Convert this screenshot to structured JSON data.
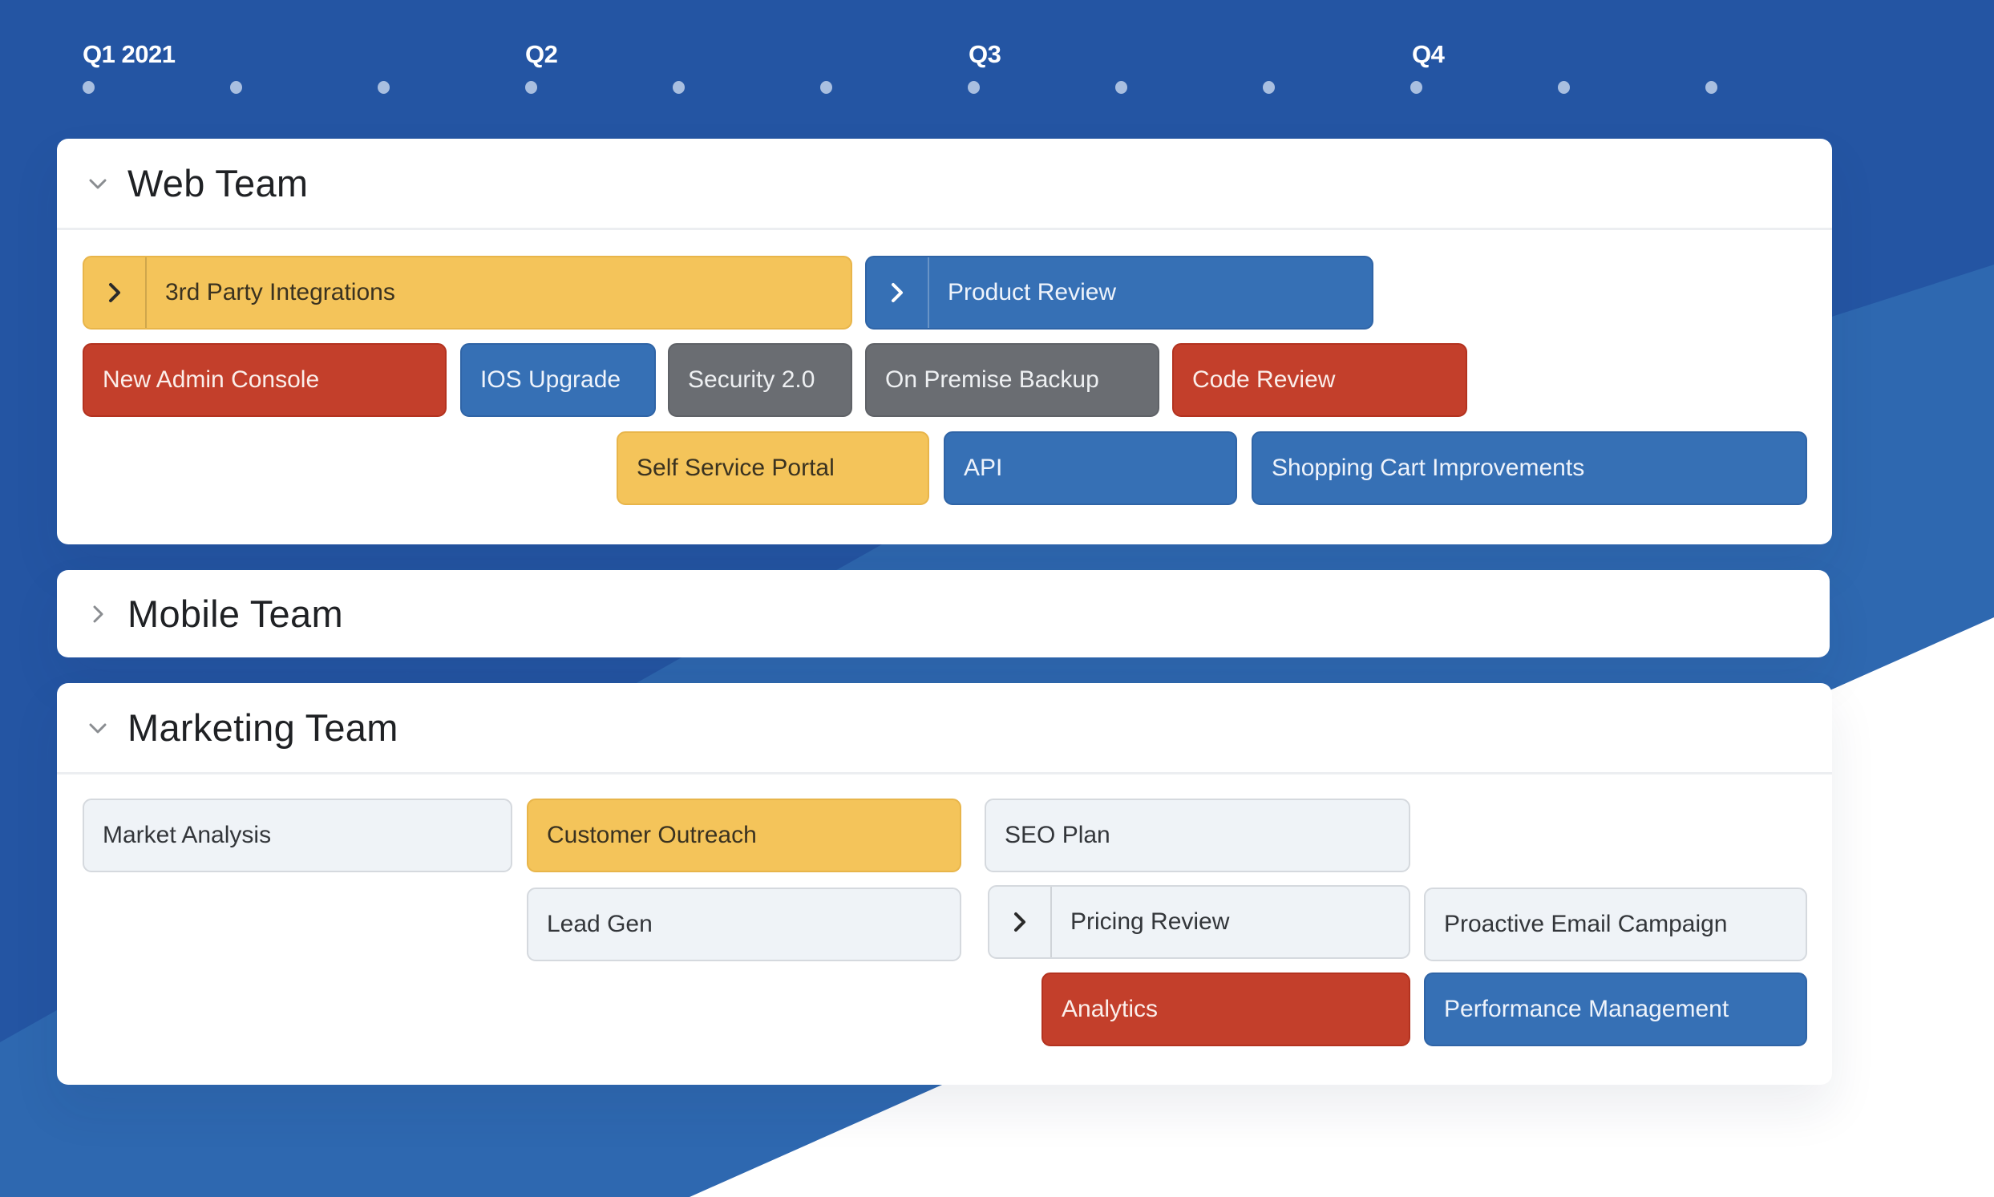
{
  "timeline": {
    "quarters": [
      "Q1 2021",
      "Q2",
      "Q3",
      "Q4"
    ],
    "month_ticks": 12
  },
  "colors": {
    "background_dark": "#2455a3",
    "background_light": "#2e68b0",
    "yellow": "#f4c45a",
    "blue": "#3670b5",
    "red": "#c33f2b",
    "gray": "#6a6d72",
    "light": "#eff3f7"
  },
  "teams": [
    {
      "name": "Web Team",
      "expanded": true,
      "items": [
        {
          "label": "3rd Party Integrations",
          "color": "yellow",
          "has_children": true
        },
        {
          "label": "Product Review",
          "color": "blue",
          "has_children": true
        },
        {
          "label": "New Admin Console",
          "color": "red"
        },
        {
          "label": "IOS Upgrade",
          "color": "blue"
        },
        {
          "label": "Security 2.0",
          "color": "gray"
        },
        {
          "label": "On Premise Backup",
          "color": "gray"
        },
        {
          "label": "Code Review",
          "color": "red"
        },
        {
          "label": "Self Service Portal",
          "color": "yellow"
        },
        {
          "label": "API",
          "color": "blue"
        },
        {
          "label": "Shopping Cart Improvements",
          "color": "blue"
        }
      ]
    },
    {
      "name": "Mobile Team",
      "expanded": false,
      "items": []
    },
    {
      "name": "Marketing Team",
      "expanded": true,
      "items": [
        {
          "label": "Market Analysis",
          "color": "light"
        },
        {
          "label": "Customer Outreach",
          "color": "yellow"
        },
        {
          "label": "SEO Plan",
          "color": "light"
        },
        {
          "label": "Lead Gen",
          "color": "light"
        },
        {
          "label": "Pricing Review",
          "color": "light",
          "has_children": true
        },
        {
          "label": "Proactive Email Campaign",
          "color": "light"
        },
        {
          "label": "Analytics",
          "color": "red"
        },
        {
          "label": "Performance Management",
          "color": "blue"
        }
      ]
    }
  ]
}
